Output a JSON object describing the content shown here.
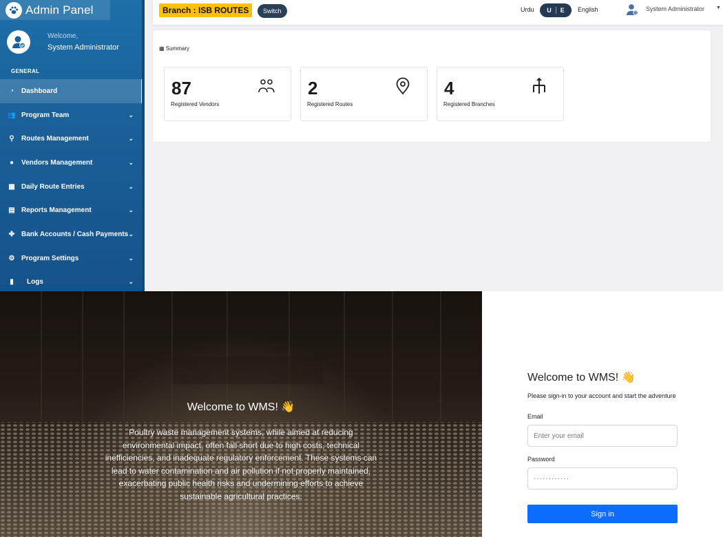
{
  "admin": {
    "brand": {
      "title": "Admin Panel",
      "icon": "paw-icon"
    },
    "welcome": {
      "greeting": "Welcome,",
      "name": "System Administrator"
    },
    "section_label": "GENERAL",
    "nav": [
      {
        "label": "Dashboard",
        "icon": "dashboard-icon",
        "active": true,
        "has_chevron": false
      },
      {
        "label": "Program Team",
        "icon": "users-icon",
        "active": false,
        "has_chevron": true
      },
      {
        "label": "Routes Management",
        "icon": "pin-icon",
        "active": false,
        "has_chevron": true
      },
      {
        "label": "Vendors Management",
        "icon": "user-icon",
        "active": false,
        "has_chevron": true
      },
      {
        "label": "Daily Route Entries",
        "icon": "calendar-icon",
        "active": false,
        "has_chevron": true
      },
      {
        "label": "Reports Management",
        "icon": "file-icon",
        "active": false,
        "has_chevron": true
      },
      {
        "label": "Bank Accounts / Cash Payments",
        "icon": "money-icon",
        "active": false,
        "has_chevron": true
      },
      {
        "label": "Program Settings",
        "icon": "cogs-icon",
        "active": false,
        "has_chevron": true
      },
      {
        "label": "Logs",
        "icon": "document-icon",
        "active": false,
        "has_chevron": true
      }
    ],
    "topbar": {
      "branch": "Branch : ISB ROUTES",
      "switch_label": "Switch",
      "lang_urdu": "Urdu",
      "lang_toggle_u": "U",
      "lang_toggle_e": "E",
      "lang_english": "English",
      "user_name": "System Administrator"
    },
    "summary": {
      "title": "Summary",
      "cards": [
        {
          "value": "87",
          "label": "Registered Vendors",
          "icon": "people-icon"
        },
        {
          "value": "2",
          "label": "Registered Routes",
          "icon": "location-icon"
        },
        {
          "value": "4",
          "label": "Registered Branches",
          "icon": "branch-icon"
        }
      ]
    },
    "colors": {
      "sidebar": "#1a5f98",
      "badge": "#ffc107",
      "toggle": "#233a52"
    }
  },
  "login": {
    "hero": {
      "title": "Welcome to WMS! 👋",
      "text": "Poultry waste management systems, while aimed at reducing environmental impact, often fall short due to high costs, technical inefficiencies, and inadequate regulatory enforcement. These systems can lead to water contamination and air pollution if not properly maintained, exacerbating public health risks and undermining efforts to achieve sustainable agricultural practices."
    },
    "form": {
      "title": "Welcome to WMS! 👋",
      "subtitle": "Please sign-in to your account and start the adventure",
      "email_label": "Email",
      "email_placeholder": "Enter your email",
      "password_label": "Password",
      "password_value": "············",
      "signin_label": "Sign in"
    },
    "colors": {
      "button": "#0d6efd"
    }
  }
}
